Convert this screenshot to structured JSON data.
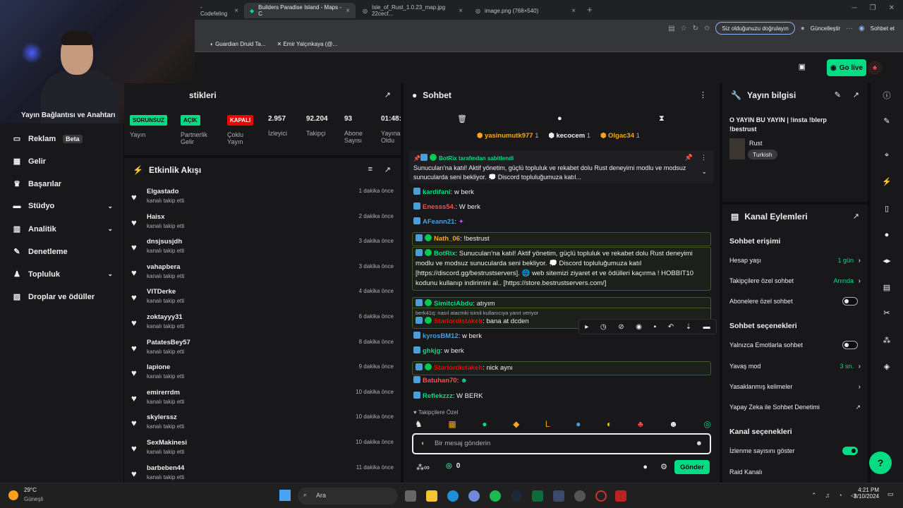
{
  "browser": {
    "tabs": [
      {
        "label": "- Codefeling",
        "active": false
      },
      {
        "label": "Builders Paradise Island - Maps - C",
        "active": true
      },
      {
        "label": "Isle_of_Rust_1.0.23_map.jpg 22cecf...",
        "active": false
      },
      {
        "label": "image.png (768×540)",
        "active": false
      }
    ],
    "verify_pill": "Siz olduğunuzu doğrulayın",
    "update_label": "Güncelleştir",
    "copilot_label": "Sohbet et",
    "bookmarks": [
      "Guardian Druid Ta...",
      "Emir Yalçınkaya (@..."
    ]
  },
  "topnav": {
    "go_live": "Go live"
  },
  "webcam_overlay": {
    "text": "Yayın Bağlantısı ve Anahtarı"
  },
  "sidebar": {
    "items": [
      {
        "label": "Reklam",
        "badge": "Beta",
        "icon": "megaphone-icon"
      },
      {
        "label": "Gelir",
        "icon": "revenue-icon"
      },
      {
        "label": "Başarılar",
        "icon": "trophy-icon"
      },
      {
        "label": "Stüdyo",
        "icon": "studio-icon"
      },
      {
        "label": "Analitik",
        "icon": "analytics-icon"
      },
      {
        "label": "Denetleme",
        "icon": "wrench-icon"
      },
      {
        "label": "Topluluk",
        "icon": "community-icon"
      },
      {
        "label": "Droplar ve ödüller",
        "icon": "gift-icon"
      }
    ]
  },
  "stats": {
    "title_partial": "stikleri",
    "items": [
      {
        "badge": "SORUNSUZ",
        "badge_color": "#00db84",
        "label": "Yayın"
      },
      {
        "badge": "AÇIK",
        "badge_color": "#00db84",
        "label": "Partnerlik Gelir"
      },
      {
        "badge": "KAPALI",
        "badge_color": "#eb0400",
        "label": "Çoklu Yayın"
      },
      {
        "value": "2.957",
        "label": "İzleyici"
      },
      {
        "value": "92.204",
        "label": "Takipçi"
      },
      {
        "value": "93",
        "label": "Abone Sayısı"
      },
      {
        "value": "01:48:",
        "label": "Yayına Oldu"
      }
    ]
  },
  "activity": {
    "title": "Etkinlik Akışı",
    "rows": [
      {
        "name": "Elgastado",
        "sub": "kanalı takip etti",
        "time": "1 dakika önce"
      },
      {
        "name": "Haisx",
        "sub": "kanalı takip etti",
        "time": "2 dakika önce"
      },
      {
        "name": "dnsjsusjdh",
        "sub": "kanalı takip etti",
        "time": "3 dakika önce"
      },
      {
        "name": "vahapbera",
        "sub": "kanalı takip etti",
        "time": "3 dakika önce"
      },
      {
        "name": "VITDerke",
        "sub": "kanalı takip etti",
        "time": "4 dakika önce"
      },
      {
        "name": "zoktayyy31",
        "sub": "kanalı takip etti",
        "time": "6 dakika önce"
      },
      {
        "name": "PatatesBey57",
        "sub": "kanalı takip etti",
        "time": "8 dakika önce"
      },
      {
        "name": "lapione",
        "sub": "kanalı takip etti",
        "time": "9 dakika önce"
      },
      {
        "name": "emirerrdm",
        "sub": "kanalı takip etti",
        "time": "10 dakika önce"
      },
      {
        "name": "skylerssz",
        "sub": "kanalı takip etti",
        "time": "10 dakika önce"
      },
      {
        "name": "SexMakinesi",
        "sub": "kanalı takip etti",
        "time": "10 dakika önce"
      },
      {
        "name": "barbeben44",
        "sub": "kanalı takip etti",
        "time": "11 dakika önce"
      }
    ]
  },
  "chat": {
    "title": "Sohbet",
    "top_users": [
      {
        "name": "yasinumutk977",
        "count": "1",
        "color": "#f5a623"
      },
      {
        "name": "kecocem",
        "count": "1",
        "color": "#efeff1"
      },
      {
        "name": "Olgac34",
        "count": "1",
        "color": "#f5a623"
      }
    ],
    "pinned": {
      "header": "BotRix tarafından sabitlendi",
      "text": "Sunucuları'na katıl! Aktif yönetim, güçlü topluluk ve rekabet dolu Rust deneyimi modlu ve modsuz sunucularda seni bekliyor. 💭 Discord topluluğumuza katıl..."
    },
    "messages": [
      {
        "name": "kardifani",
        "color": "#00db84",
        "text": ": w berk"
      },
      {
        "name": "Enesss54.",
        "color": "#ff4d4d",
        "text": ": W berk"
      },
      {
        "name": "AFeann21",
        "color": "#4a9fd8",
        "text": ":"
      },
      {
        "name": "Nath_06",
        "color": "#f5a623",
        "text": ": !bestrust"
      },
      {
        "name": "BotRix",
        "color": "#00db84",
        "text": ": Sunucuları'na katıl! Aktif yönetim, güçlü topluluk ve rekabet dolu Rust deneyimi modlu ve modsuz sunucularda seni bekliyor. 💭 Discord topluluğumuza katıl [https://discord.gg/bestrustservers]. 🌐 web sitemizi ziyaret et ve ödülleri kaçırma ! HOBBIT10 kodunu kullanıp indirimini al.. [https://store.bestrustservers.com/]"
      },
      {
        "name": "SimitciAbdu",
        "color": "#00db84",
        "text": ": atıyım"
      },
      {
        "reply": "berk41q: nasıl atacmki isimli kullanıcıya yanıt veriyor",
        "name": "Starlordistakeh",
        "color": "#eb0400",
        "text": ": bana at dcden"
      },
      {
        "name": "kyrosBM12",
        "color": "#4a9fd8",
        "text": ": w berk"
      },
      {
        "name": "ghkjg",
        "color": "#00db84",
        "text": ": w berk"
      },
      {
        "name": "Starlordistakeh",
        "color": "#eb0400",
        "text": ": nick aynı"
      },
      {
        "name": "Batuhan70",
        "color": "#ff4d4d",
        "text": ":"
      },
      {
        "name": "Reflekzzz",
        "color": "#00db84",
        "text": ": W BERK"
      }
    ],
    "followers_only": "Takipçilere Özel",
    "input_placeholder": "Bir mesaj gönderin",
    "points": "0",
    "send_label": "Gönder"
  },
  "stream_info": {
    "title": "Yayın bilgisi",
    "stream_title": "O YAYIN BU YAYIN | !insta !blerp !bestrust",
    "category": "Rust",
    "tag": "Turkish"
  },
  "channel_actions": {
    "title": "Kanal Eylemleri",
    "chat_access": "Sohbet erişimi",
    "account_age_label": "Hesap yaşı",
    "account_age_value": "1 gün",
    "followers_chat_label": "Takipçilere özel sohbet",
    "followers_chat_value": "Anında",
    "subs_chat_label": "Abonelere özel sohbet",
    "chat_options": "Sohbet seçenekleri",
    "emote_only_label": "Yalnızca Emotlarla sohbet",
    "slow_mode_label": "Yavaş mod",
    "slow_mode_value": "3 sn.",
    "banned_words_label": "Yasaklanmış kelimeler",
    "ai_moderation_label": "Yapay Zeka ile Sohbet Denetimi",
    "channel_options": "Kanal seçenekleri",
    "show_viewers_label": "İzlenme sayısını göster",
    "raid_label": "Raid Kanalı"
  },
  "taskbar": {
    "weather_temp": "29°C",
    "weather_desc": "Güneşli",
    "search": "Ara",
    "time": "4:21 PM",
    "date": "8/10/2024"
  },
  "colors": {
    "accent": "#00db84",
    "danger": "#eb0400"
  }
}
